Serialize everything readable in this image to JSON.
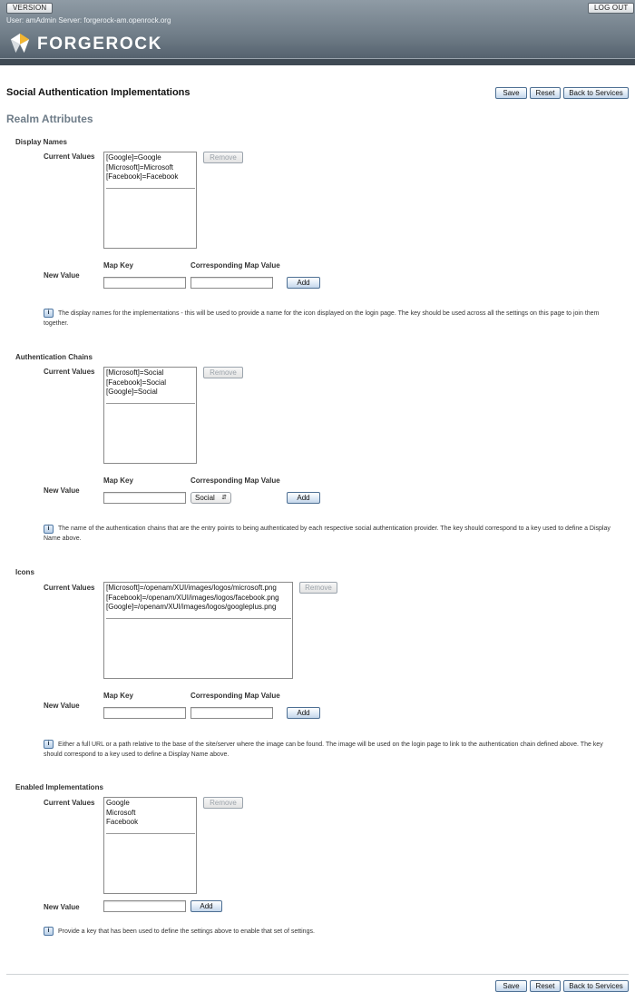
{
  "masthead": {
    "version_label": "VERSION",
    "logout_label": "LOG OUT",
    "user_line": "User: amAdmin   Server: forgerock-am.openrock.org",
    "logo_text": "FORGEROCK"
  },
  "page": {
    "title": "Social Authentication Implementations",
    "realm_title": "Realm Attributes",
    "save_label": "Save",
    "reset_label": "Reset",
    "back_label": "Back to Services"
  },
  "labels": {
    "current_values": "Current Values",
    "new_value": "New Value",
    "map_key": "Map Key",
    "map_value": "Corresponding Map Value",
    "remove": "Remove",
    "add": "Add"
  },
  "display_names": {
    "title": "Display Names",
    "values": [
      "[Google]=Google",
      "[Microsoft]=Microsoft",
      "[Facebook]=Facebook"
    ],
    "help": "The display names for the implementations - this will be used to provide a name for the icon displayed on the login page. The key should be used across all the settings on this page to join them together."
  },
  "auth_chains": {
    "title": "Authentication Chains",
    "values": [
      "[Microsoft]=Social",
      "[Facebook]=Social",
      "[Google]=Social"
    ],
    "select_value": "Social",
    "help": "The name of the authentication chains that are the entry points to being authenticated by each respective social authentication provider. The key should correspond to a key used to define a Display Name above."
  },
  "icons": {
    "title": "Icons",
    "values": [
      "[Microsoft]=/openam/XUI/images/logos/microsoft.png",
      "[Facebook]=/openam/XUI/images/logos/facebook.png",
      "[Google]=/openam/XUI/images/logos/googleplus.png"
    ],
    "help": "Either a full URL or a path relative to the base of the site/server where the image can be found. The image will be used on the login page to link to the authentication chain defined above. The key should correspond to a key used to define a Display Name above."
  },
  "enabled": {
    "title": "Enabled Implementations",
    "values": [
      "Google",
      "Microsoft",
      "Facebook"
    ],
    "help": "Provide a key that has been used to define the settings above to enable that set of settings."
  },
  "info_icon_glyph": "i"
}
